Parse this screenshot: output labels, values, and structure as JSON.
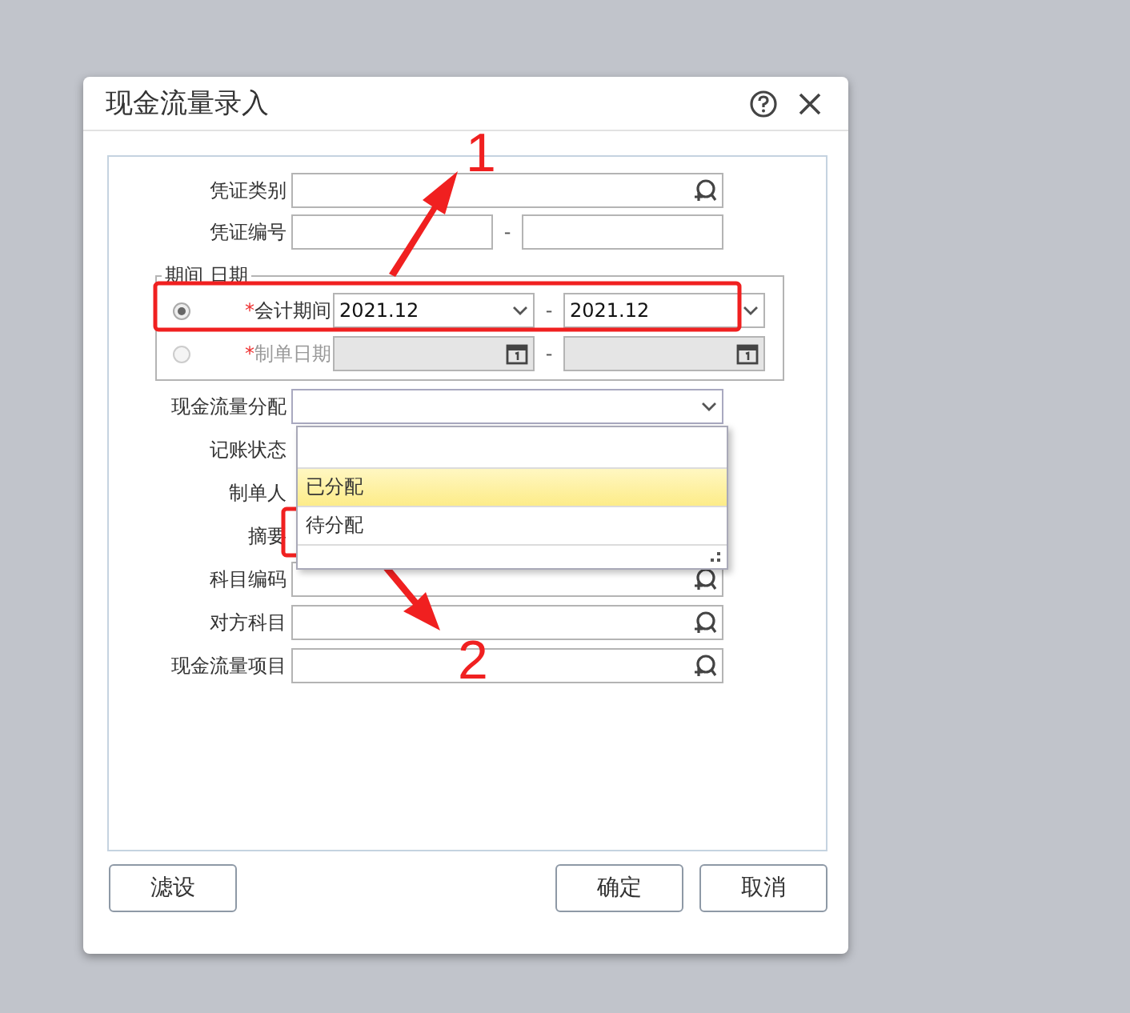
{
  "dialog": {
    "title": "现金流量录入"
  },
  "top_fields": [
    {
      "label": "凭证类别",
      "kind": "lookup"
    },
    {
      "label": "凭证编号",
      "kind": "range",
      "separator": "-"
    }
  ],
  "period_group": {
    "legend": "期间 日期",
    "options": [
      {
        "required_mark": "*",
        "label": "会计期间",
        "selected": true,
        "disabled": false,
        "kind": "select",
        "from": "2021.12",
        "separator": "-",
        "to": "2021.12"
      },
      {
        "required_mark": "*",
        "label": "制单日期",
        "selected": false,
        "disabled": true,
        "kind": "date",
        "separator": "-"
      }
    ]
  },
  "lower_fields": [
    {
      "label": "现金流量分配",
      "kind": "select",
      "expanded": true
    },
    {
      "label": "记账状态",
      "kind": "covered"
    },
    {
      "label": "制单人",
      "kind": "covered"
    },
    {
      "label": "摘要",
      "kind": "covered"
    },
    {
      "label": "科目编码",
      "kind": "lookup"
    },
    {
      "label": "对方科目",
      "kind": "lookup"
    },
    {
      "label": "现金流量项目",
      "kind": "lookup"
    }
  ],
  "dropdown": {
    "options": [
      {
        "label": "已分配",
        "selected": true
      },
      {
        "label": "待分配",
        "selected": false
      }
    ]
  },
  "buttons": [
    {
      "label": "滤设"
    },
    {
      "label": "确定"
    },
    {
      "label": "取消"
    }
  ],
  "annotations": [
    {
      "number": "1"
    },
    {
      "number": "2"
    }
  ]
}
